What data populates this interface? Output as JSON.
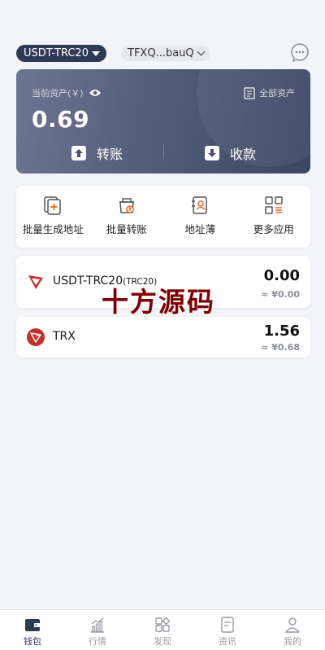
{
  "header": {
    "chain_selector": "USDT-TRC20",
    "address": "TFXQ...bauQ"
  },
  "balance_card": {
    "label": "当前资产(￥)",
    "all_assets": "全部资产",
    "amount": "0.69",
    "send_label": "转账",
    "receive_label": "收款"
  },
  "quick_actions": [
    {
      "label": "批量生成地址"
    },
    {
      "label": "批量转账"
    },
    {
      "label": "地址薄"
    },
    {
      "label": "更多应用"
    }
  ],
  "assets": [
    {
      "name": "USDT-TRC20",
      "tag": "(TRC20)",
      "balance": "0.00",
      "fiat": "≈ ¥0.00"
    },
    {
      "name": "TRX",
      "tag": "",
      "balance": "1.56",
      "fiat": "≈ ¥0.68"
    }
  ],
  "watermark": "十方源码",
  "tabs": [
    {
      "label": "钱包"
    },
    {
      "label": "行情"
    },
    {
      "label": "发现"
    },
    {
      "label": "资讯"
    },
    {
      "label": "我的"
    }
  ],
  "colors": {
    "accent": "#2f3a56",
    "tron_red": "#c4302b",
    "watermark": "#7d0000"
  }
}
